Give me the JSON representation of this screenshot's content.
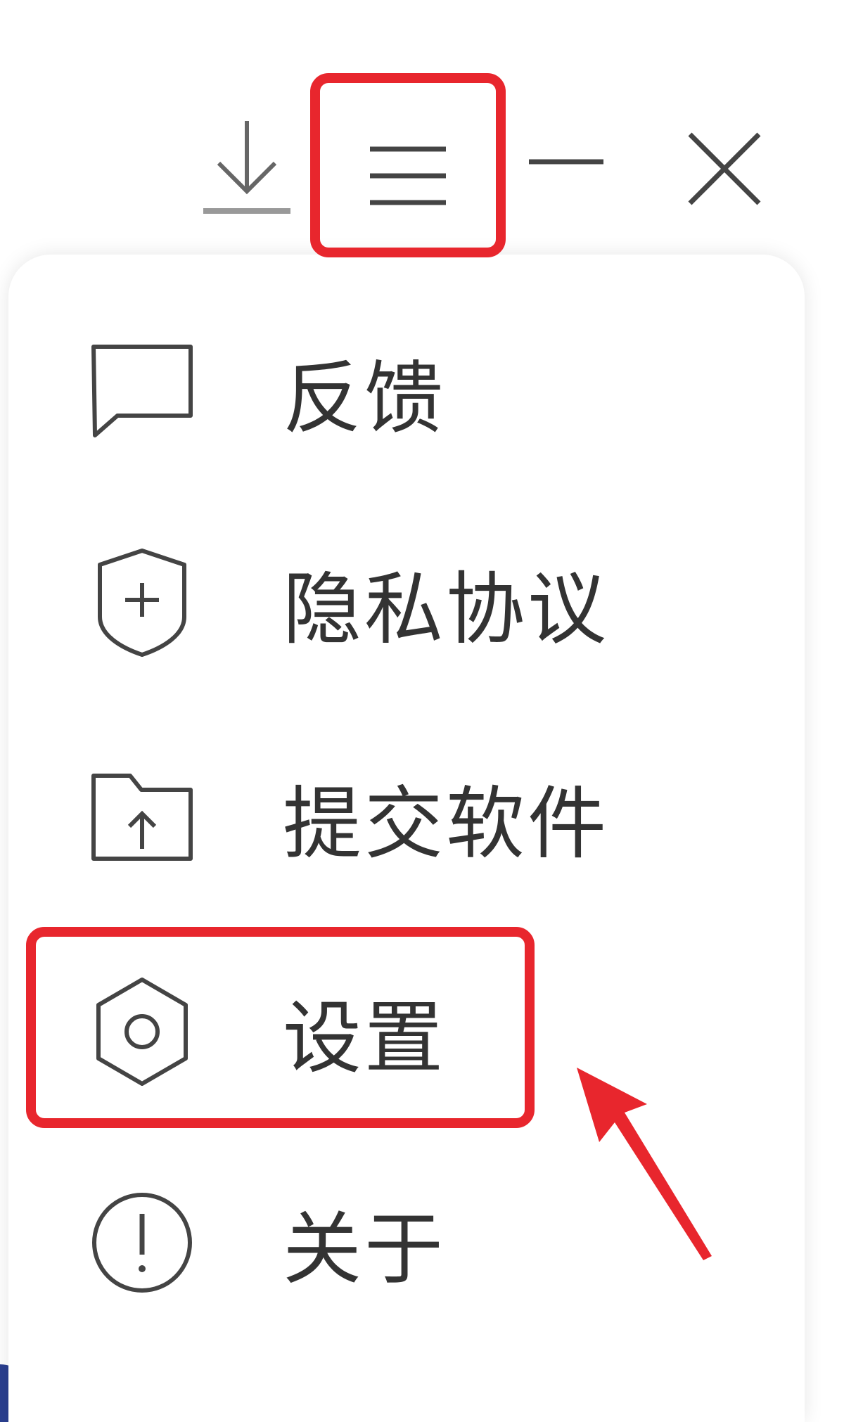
{
  "titlebar": {
    "download": {
      "icon": "download-icon"
    },
    "menu": {
      "icon": "hamburger-menu-icon"
    },
    "minimize": {
      "icon": "minimize-icon"
    },
    "close": {
      "icon": "close-icon"
    }
  },
  "menu": {
    "items": [
      {
        "label": "反馈",
        "icon": "chat-bubble-icon"
      },
      {
        "label": "隐私协议",
        "icon": "shield-plus-icon"
      },
      {
        "label": "提交软件",
        "icon": "folder-upload-icon"
      },
      {
        "label": "设置",
        "icon": "hexagon-settings-icon"
      },
      {
        "label": "关于",
        "icon": "info-circle-icon"
      }
    ]
  },
  "annotations": {
    "highlight_color": "#e8262d",
    "highlighted_targets": [
      "hamburger-menu",
      "settings"
    ]
  },
  "colors": {
    "text": "#333333",
    "icon_stroke": "#444444",
    "accent_corner": "#2a3f8f"
  }
}
